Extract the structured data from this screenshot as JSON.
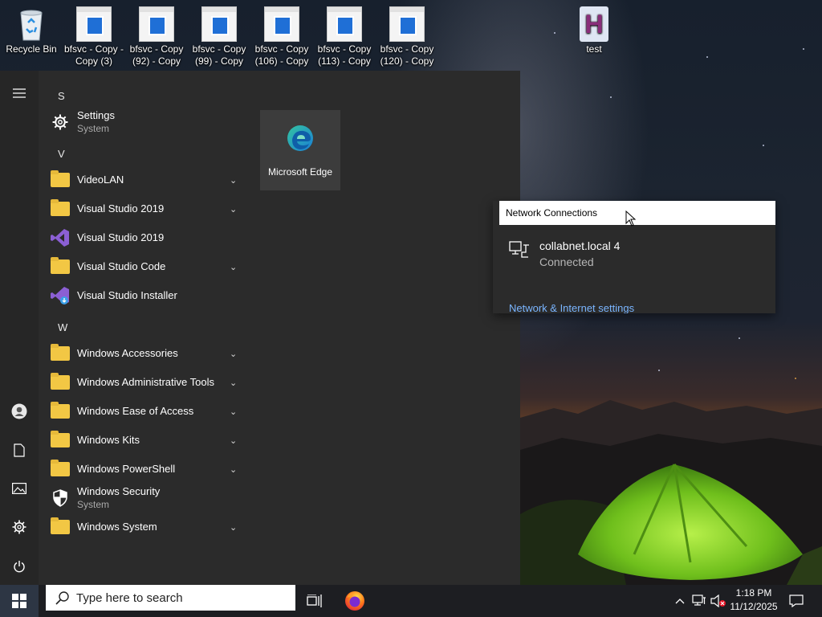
{
  "desktop": {
    "icons": [
      {
        "label": "Recycle Bin",
        "icon": "recycle-bin-icon"
      },
      {
        "label": "bfsvc - Copy - Copy (3)",
        "icon": "document-icon"
      },
      {
        "label": "bfsvc - Copy (92) - Copy",
        "icon": "document-icon"
      },
      {
        "label": "bfsvc - Copy (99) - Copy",
        "icon": "document-icon"
      },
      {
        "label": "bfsvc - Copy (106) - Copy",
        "icon": "document-icon"
      },
      {
        "label": "bfsvc - Copy (113) - Copy",
        "icon": "document-icon"
      },
      {
        "label": "bfsvc - Copy (120) - Copy",
        "icon": "document-icon"
      },
      {
        "label": "test",
        "icon": "h-document-icon",
        "glyph": "H"
      }
    ]
  },
  "start_menu": {
    "letters": {
      "s": "S",
      "v": "V",
      "w": "W"
    },
    "apps": [
      {
        "label": "Settings",
        "sub": "System",
        "icon": "gear-icon"
      },
      {
        "label": "VideoLAN",
        "icon": "folder-icon",
        "expandable": true
      },
      {
        "label": "Visual Studio 2019",
        "icon": "folder-icon",
        "expandable": true
      },
      {
        "label": "Visual Studio 2019",
        "icon": "visual-studio-icon"
      },
      {
        "label": "Visual Studio Code",
        "icon": "folder-icon",
        "expandable": true
      },
      {
        "label": "Visual Studio Installer",
        "icon": "visual-studio-installer-icon"
      },
      {
        "label": "Windows Accessories",
        "icon": "folder-icon",
        "expandable": true
      },
      {
        "label": "Windows Administrative Tools",
        "icon": "folder-icon",
        "expandable": true
      },
      {
        "label": "Windows Ease of Access",
        "icon": "folder-icon",
        "expandable": true
      },
      {
        "label": "Windows Kits",
        "icon": "folder-icon",
        "expandable": true
      },
      {
        "label": "Windows PowerShell",
        "icon": "folder-icon",
        "expandable": true
      },
      {
        "label": "Windows Security",
        "sub": "System",
        "icon": "shield-icon"
      },
      {
        "label": "Windows System",
        "icon": "folder-icon",
        "expandable": true
      }
    ],
    "tile": {
      "label": "Microsoft Edge",
      "icon": "edge-icon"
    }
  },
  "network_flyout": {
    "title": "Network Connections",
    "connection_name": "collabnet.local 4",
    "connection_status": "Connected",
    "settings_link": "Network & Internet settings"
  },
  "taskbar": {
    "search_placeholder": "Type here to search",
    "time": "1:18 PM",
    "date": "11/12/2025"
  },
  "colors": {
    "start_bg": "#2b2b2b",
    "taskbar_bg": "#1d1e22",
    "folder": "#f2c744",
    "link": "#7ab5ff"
  }
}
